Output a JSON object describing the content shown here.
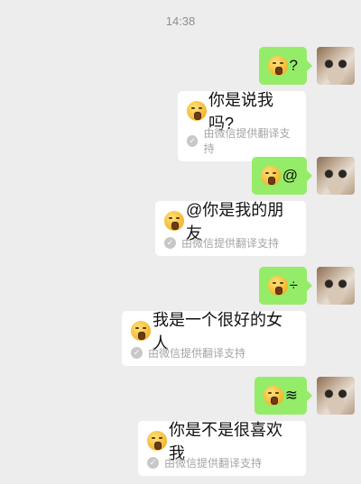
{
  "chat": {
    "timestamp": "14:38",
    "messages": [
      {
        "sent": "?",
        "emoji_icon": "speechless-emoji-icon",
        "translation": "你是说我吗?"
      },
      {
        "sent": "@",
        "emoji_icon": "speechless-emoji-icon",
        "translation": "@你是我的朋友"
      },
      {
        "sent": "÷",
        "emoji_icon": "speechless-emoji-icon",
        "translation": "我是一个很好的女人"
      },
      {
        "sent": "≋",
        "emoji_icon": "speechless-emoji-icon",
        "translation": "你是不是很喜欢我"
      }
    ],
    "translation_note": "由微信提供翻译支持"
  },
  "colors": {
    "sent_bubble": "#95ec69",
    "background": "#ededed",
    "received_bubble": "#ffffff"
  }
}
